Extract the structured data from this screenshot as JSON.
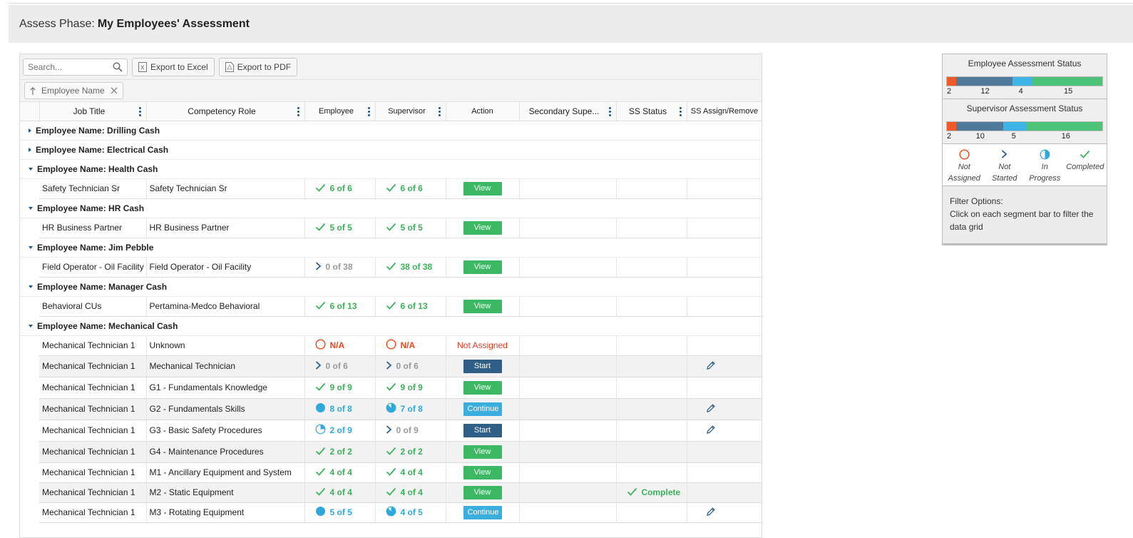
{
  "header": {
    "prefix": "Assess Phase:",
    "title": "My Employees' Assessment"
  },
  "toolbar": {
    "search_placeholder": "Search...",
    "export_excel": "Export to Excel",
    "export_pdf": "Export to PDF",
    "group_chip": "Employee Name"
  },
  "columns": [
    "Job Title",
    "Competency Role",
    "Employee",
    "Supervisor",
    "Action",
    "Secondary Supe...",
    "SS Status",
    "SS Assign/Remove"
  ],
  "groups": [
    {
      "label": "Employee Name: Drilling Cash",
      "expanded": false
    },
    {
      "label": "Employee Name: Electrical Cash",
      "expanded": false
    },
    {
      "label": "Employee Name: Health Cash",
      "expanded": true
    },
    {
      "label": "Employee Name: HR Cash",
      "expanded": true
    },
    {
      "label": "Employee Name: Jim Pebble",
      "expanded": true
    },
    {
      "label": "Employee Name: Manager Cash",
      "expanded": true
    },
    {
      "label": "Employee Name: Mechanical Cash",
      "expanded": true
    }
  ],
  "rows": [
    {
      "job": "Safety Technician Sr",
      "role": "Safety Technician Sr",
      "emp": "6 of 6",
      "emp_status": "completed",
      "sup": "6 of 6",
      "sup_status": "completed",
      "action": "View",
      "ss_status": "",
      "ss_assign": false
    },
    {
      "job": "HR Business Partner",
      "role": "HR Business Partner",
      "emp": "5 of 5",
      "emp_status": "completed",
      "sup": "5 of 5",
      "sup_status": "completed",
      "action": "View",
      "ss_status": "",
      "ss_assign": false
    },
    {
      "job": "Field Operator - Oil Facility",
      "role": "Field Operator - Oil Facility",
      "emp": "0 of 38",
      "emp_status": "not-started",
      "sup": "38 of 38",
      "sup_status": "completed",
      "action": "View",
      "ss_status": "",
      "ss_assign": false
    },
    {
      "job": "Behavioral CUs",
      "role": "Pertamina-Medco Behavioral",
      "emp": "6 of 13",
      "emp_status": "completed",
      "sup": "6 of 13",
      "sup_status": "completed",
      "action": "View",
      "ss_status": "",
      "ss_assign": false
    },
    {
      "job": "Mechanical Technician 1",
      "role": "Unknown",
      "emp": "N/A",
      "emp_status": "not-assigned",
      "sup": "N/A",
      "sup_status": "not-assigned",
      "action": "Not Assigned",
      "ss_status": "",
      "ss_assign": false
    },
    {
      "job": "Mechanical Technician 1",
      "role": "Mechanical Technician",
      "emp": "0 of 6",
      "emp_status": "not-started",
      "sup": "0 of 6",
      "sup_status": "not-started",
      "action": "Start",
      "ss_status": "",
      "ss_assign": true
    },
    {
      "job": "Mechanical Technician 1",
      "role": "G1 - Fundamentals Knowledge",
      "emp": "9 of 9",
      "emp_status": "completed",
      "sup": "9 of 9",
      "sup_status": "completed",
      "action": "View",
      "ss_status": "",
      "ss_assign": false
    },
    {
      "job": "Mechanical Technician 1",
      "role": "G2 - Fundamentals Skills",
      "emp": "8 of 8",
      "emp_status": "in-progress-full",
      "sup": "7 of 8",
      "sup_status": "in-progress-most",
      "action": "Continue",
      "ss_status": "",
      "ss_assign": true
    },
    {
      "job": "Mechanical Technician 1",
      "role": "G3 - Basic Safety Procedures",
      "emp": "2 of 9",
      "emp_status": "in-progress-low",
      "sup": "0 of 9",
      "sup_status": "not-started",
      "action": "Start",
      "ss_status": "",
      "ss_assign": true
    },
    {
      "job": "Mechanical Technician 1",
      "role": "G4 - Maintenance Procedures",
      "emp": "2 of 2",
      "emp_status": "completed",
      "sup": "2 of 2",
      "sup_status": "completed",
      "action": "View",
      "ss_status": "",
      "ss_assign": false
    },
    {
      "job": "Mechanical Technician 1",
      "role": "M1 - Ancillary Equipment and System",
      "emp": "4 of 4",
      "emp_status": "completed",
      "sup": "4 of 4",
      "sup_status": "completed",
      "action": "View",
      "ss_status": "",
      "ss_assign": false
    },
    {
      "job": "Mechanical Technician 1",
      "role": "M2 - Static Equipment",
      "emp": "4 of 4",
      "emp_status": "completed",
      "sup": "4 of 4",
      "sup_status": "completed",
      "action": "View",
      "ss_status": "Complete",
      "ss_assign": false
    },
    {
      "job": "Mechanical Technician 1",
      "role": "M3 - Rotating Equipment",
      "emp": "5 of 5",
      "emp_status": "in-progress-full",
      "sup": "4 of 5",
      "sup_status": "in-progress-most",
      "action": "Continue",
      "ss_status": "",
      "ss_assign": true
    }
  ],
  "panel": {
    "employee_title": "Employee Assessment Status",
    "employee_counts": [
      2,
      12,
      4,
      15
    ],
    "employee_labels": [
      "2",
      "12",
      "4",
      "15"
    ],
    "supervisor_title": "Supervisor Assessment Status",
    "supervisor_counts": [
      2,
      10,
      5,
      16
    ],
    "supervisor_labels": [
      "2",
      "10",
      "5",
      "16"
    ],
    "segment_colors": [
      "#f05a28",
      "#4f7a9c",
      "#3db3e6",
      "#4cc378"
    ],
    "legend": [
      {
        "icon": "not-assigned-icon",
        "line1": "Not",
        "line2": "Assigned"
      },
      {
        "icon": "not-started-icon",
        "line1": "Not",
        "line2": "Started"
      },
      {
        "icon": "in-progress-icon",
        "line1": "In",
        "line2": "Progress"
      },
      {
        "icon": "completed-icon",
        "line1": "Completed",
        "line2": ""
      }
    ],
    "filter_title": "Filter Options:",
    "filter_text": "Click on each segment bar to filter the data grid"
  }
}
